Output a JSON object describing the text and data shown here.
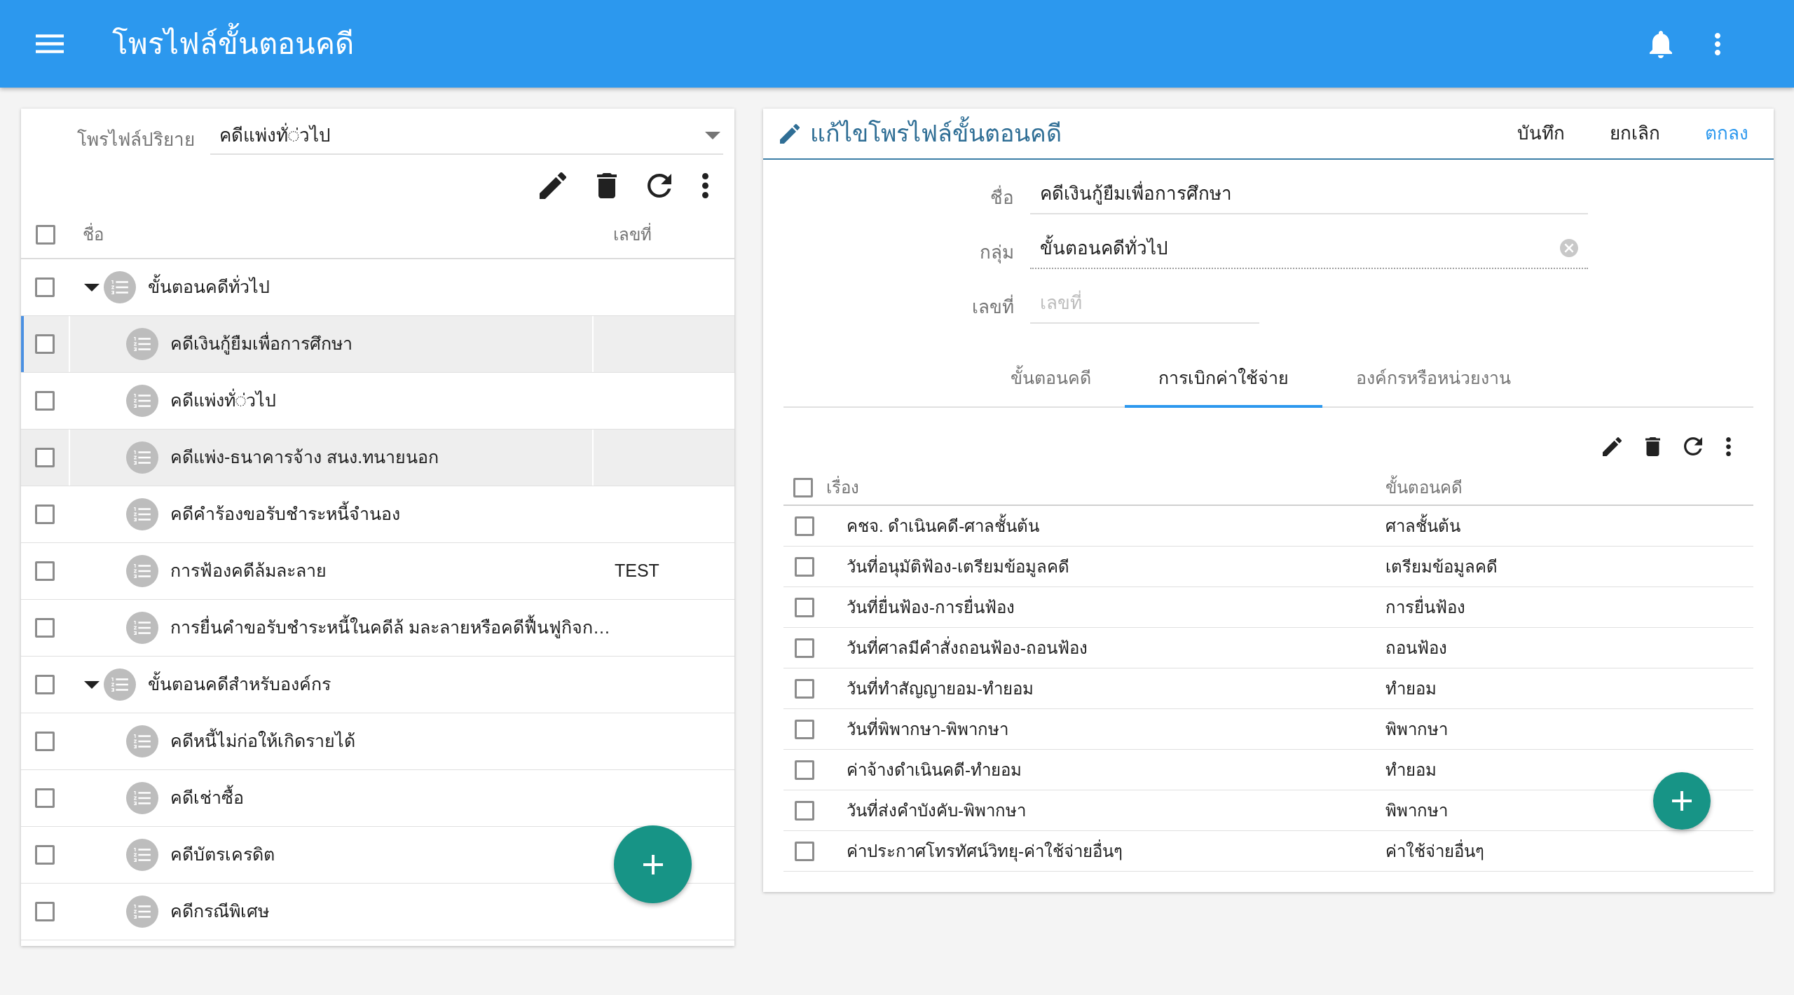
{
  "app_bar": {
    "title": "โพรไฟล์ขั้นตอนคดี"
  },
  "profile_list": {
    "default_profile": {
      "label": "โพรไฟล์ปริยาย",
      "value": "คดีแพ่งทั่◌่วไป"
    },
    "columns": [
      "ชื่อ",
      "เลขที่"
    ],
    "header_checked": false,
    "rows": [
      {
        "name": "ขั้นตอนคดีทั่วไป",
        "checked": false,
        "selected": false,
        "active": false,
        "expanded": true,
        "children": [
          {
            "name": "คดีเงินกู้ยืมเพื่อการศึกษา",
            "checked": false,
            "selected": true,
            "active": true
          },
          {
            "name": "คดีแพ่งทั่◌่วไป",
            "checked": false,
            "selected": false,
            "active": false
          },
          {
            "name": "คดีแพ่ง-ธนาคารจ้าง สนง.ทนายนอก",
            "checked": false,
            "selected": true,
            "active": false
          },
          {
            "name": "คดีคำร้องขอรับชำระหนี้จำนอง",
            "checked": false,
            "selected": false,
            "active": false
          },
          {
            "name": "การฟ้องคดีล้มละลาย",
            "number": "TEST",
            "checked": false,
            "selected": false,
            "active": false
          },
          {
            "name": "การยื่นคำขอรับชำระหนี้ในคดีล้ มละลายหรือคดีฟื้นฟูกิจก…",
            "checked": false,
            "selected": false,
            "active": false
          }
        ]
      },
      {
        "name": "ขั้นตอนคดีสำหรับองค์กร",
        "checked": false,
        "selected": false,
        "active": false,
        "expanded": true,
        "children": [
          {
            "name": "คดีหนี้ไม่ก่อให้เกิดรายได้",
            "checked": false,
            "selected": false,
            "active": false
          },
          {
            "name": "คดีเช่าซื้อ",
            "checked": false,
            "selected": false,
            "active": false
          },
          {
            "name": "คดีบัตรเครดิต",
            "checked": false,
            "selected": false,
            "active": false
          },
          {
            "name": "คดีกรณีพิเศษ",
            "checked": false,
            "selected": false,
            "active": false
          }
        ]
      }
    ]
  },
  "edit_panel": {
    "title": "แก้ไขโพรไฟล์ขั้นตอนคดี",
    "actions": [
      {
        "label": "บันทึก",
        "primary": false
      },
      {
        "label": "ยกเลิก",
        "primary": false
      },
      {
        "label": "ตกลง",
        "primary": true
      }
    ],
    "fields": [
      {
        "kind": "text",
        "label": "ชื่อ",
        "value": "คดีเงินกู้ยืมเพื่อการศึกษา"
      },
      {
        "kind": "select",
        "label": "กลุ่ม",
        "value": "ขั้นตอนคดีทั่วไป"
      },
      {
        "kind": "number",
        "label": "เลขที่",
        "placeholder": "เลขที่"
      }
    ],
    "tabs": [
      {
        "label": "ขั้นตอนคดี",
        "selected": false
      },
      {
        "label": "การเบิกค่าใช้จ่าย",
        "selected": true
      },
      {
        "label": "องค์กรหรือหน่วยงาน",
        "selected": false
      }
    ],
    "table": {
      "columns": [
        "เรื่อง",
        "ขั้นตอนคดี"
      ],
      "header_checked": false,
      "rows": [
        {
          "subject": "คชจ. ดำเนินคดี-ศาลชั้นต้น",
          "stage": "ศาลชั้นต้น",
          "checked": false
        },
        {
          "subject": "วันที่อนุมัติฟ้อง-เตรียมข้อมูลคดี",
          "stage": "เตรียมข้อมูลคดี",
          "checked": false
        },
        {
          "subject": "วันที่ยื่นฟ้อง-การยื่นฟ้อง",
          "stage": "การยื่นฟ้อง",
          "checked": false
        },
        {
          "subject": "วันที่ศาลมีคำสั่งถอนฟ้อง-ถอนฟ้อง",
          "stage": "ถอนฟ้อง",
          "checked": false
        },
        {
          "subject": "วันที่ทำสัญญายอม-ทำยอม",
          "stage": "ทำยอม",
          "checked": false
        },
        {
          "subject": "วันที่พิพากษา-พิพากษา",
          "stage": "พิพากษา",
          "checked": false
        },
        {
          "subject": "ค่าจ้างดำเนินคดี-ทำยอม",
          "stage": "ทำยอม",
          "checked": false
        },
        {
          "subject": "วันที่ส่งคำบังคับ-พิพากษา",
          "stage": "พิพากษา",
          "checked": false
        },
        {
          "subject": "ค่าประกาศโทรทัศน์วิทยุ-ค่าใช้จ่ายอื่นๆ",
          "stage": "ค่าใช้จ่ายอื่นๆ",
          "checked": false
        }
      ]
    }
  }
}
